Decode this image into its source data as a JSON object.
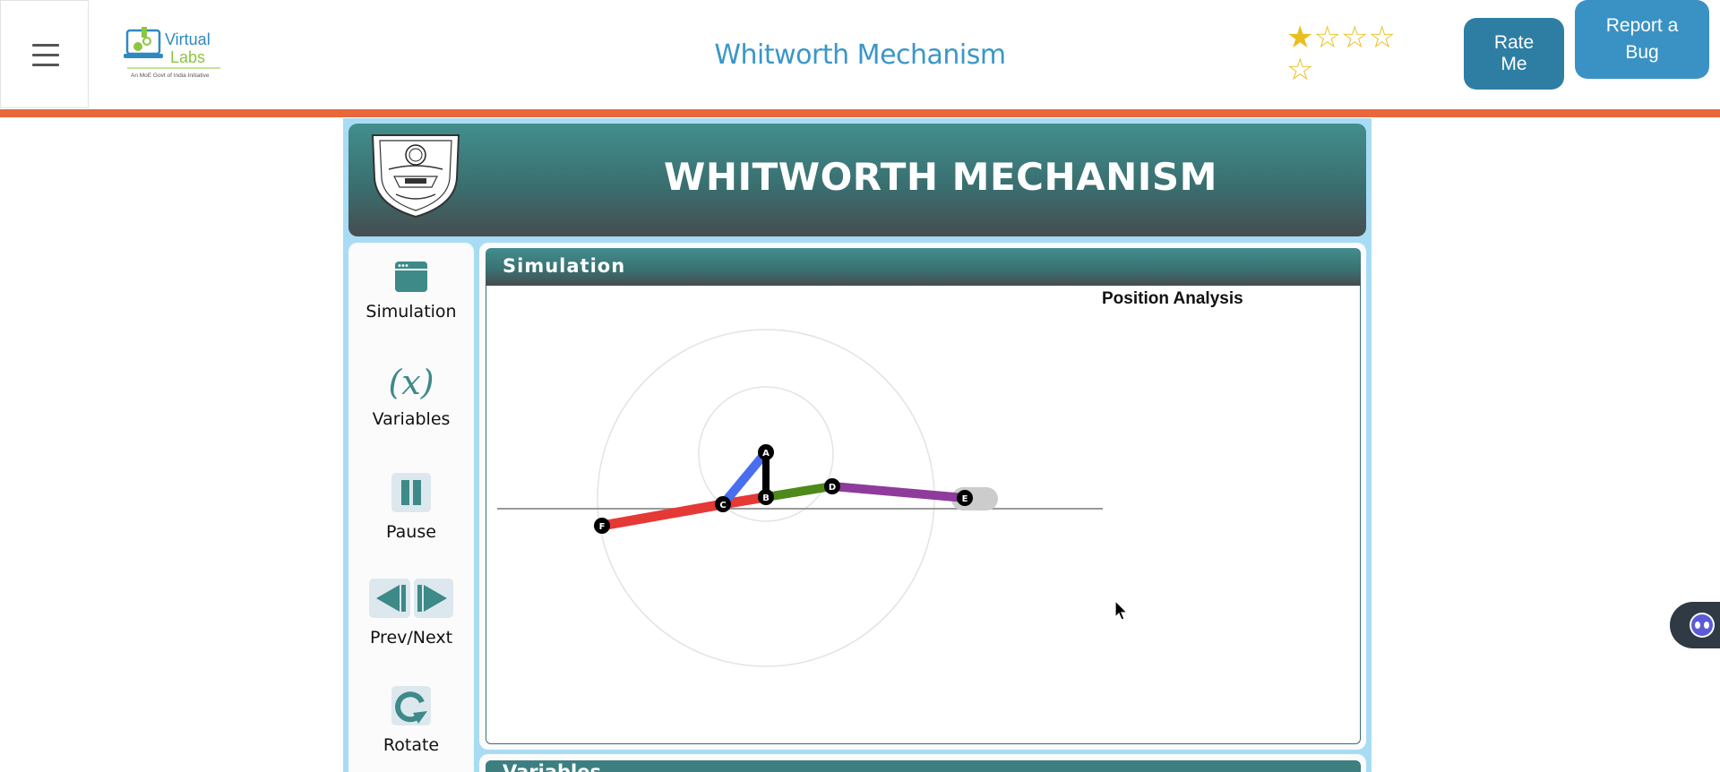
{
  "header": {
    "logo_text_line1": "Virtual",
    "logo_text_line2": "Labs",
    "logo_tagline": "An MoE Govt of India Initiative",
    "title": "Whitworth Mechanism",
    "rating": {
      "filled": 1,
      "total": 5
    },
    "rate_button": "Rate Me",
    "bug_button": "Report a Bug"
  },
  "banner": {
    "title": "WHITWORTH MECHANISM"
  },
  "sidebar": {
    "items": [
      {
        "label": "Simulation",
        "icon": "browser-window-icon"
      },
      {
        "label": "Variables",
        "icon": "function-x-icon"
      },
      {
        "label": "Pause",
        "icon": "pause-icon"
      },
      {
        "label": "Prev/Next",
        "icon": "prev-next-icon"
      },
      {
        "label": "Rotate",
        "icon": "rotate-icon"
      }
    ]
  },
  "simulation": {
    "header": "Simulation",
    "position_label": "Position Analysis",
    "joints": [
      "A",
      "B",
      "C",
      "D",
      "E",
      "F"
    ],
    "link_colors": {
      "crank": "#4a6ef0",
      "frame": "#000000",
      "slotted_lever": "#e53935",
      "lever_ext": "#4e8a1a",
      "connecting_rod": "#8e3b9c",
      "slider": "#cccccc"
    }
  },
  "next_section": {
    "header": "Variables"
  },
  "colors": {
    "accent_blue": "#3b97c8",
    "orange_stripe": "#e8683a",
    "teal_header": "#3a6f70",
    "star_gold": "#e8bf1f"
  }
}
